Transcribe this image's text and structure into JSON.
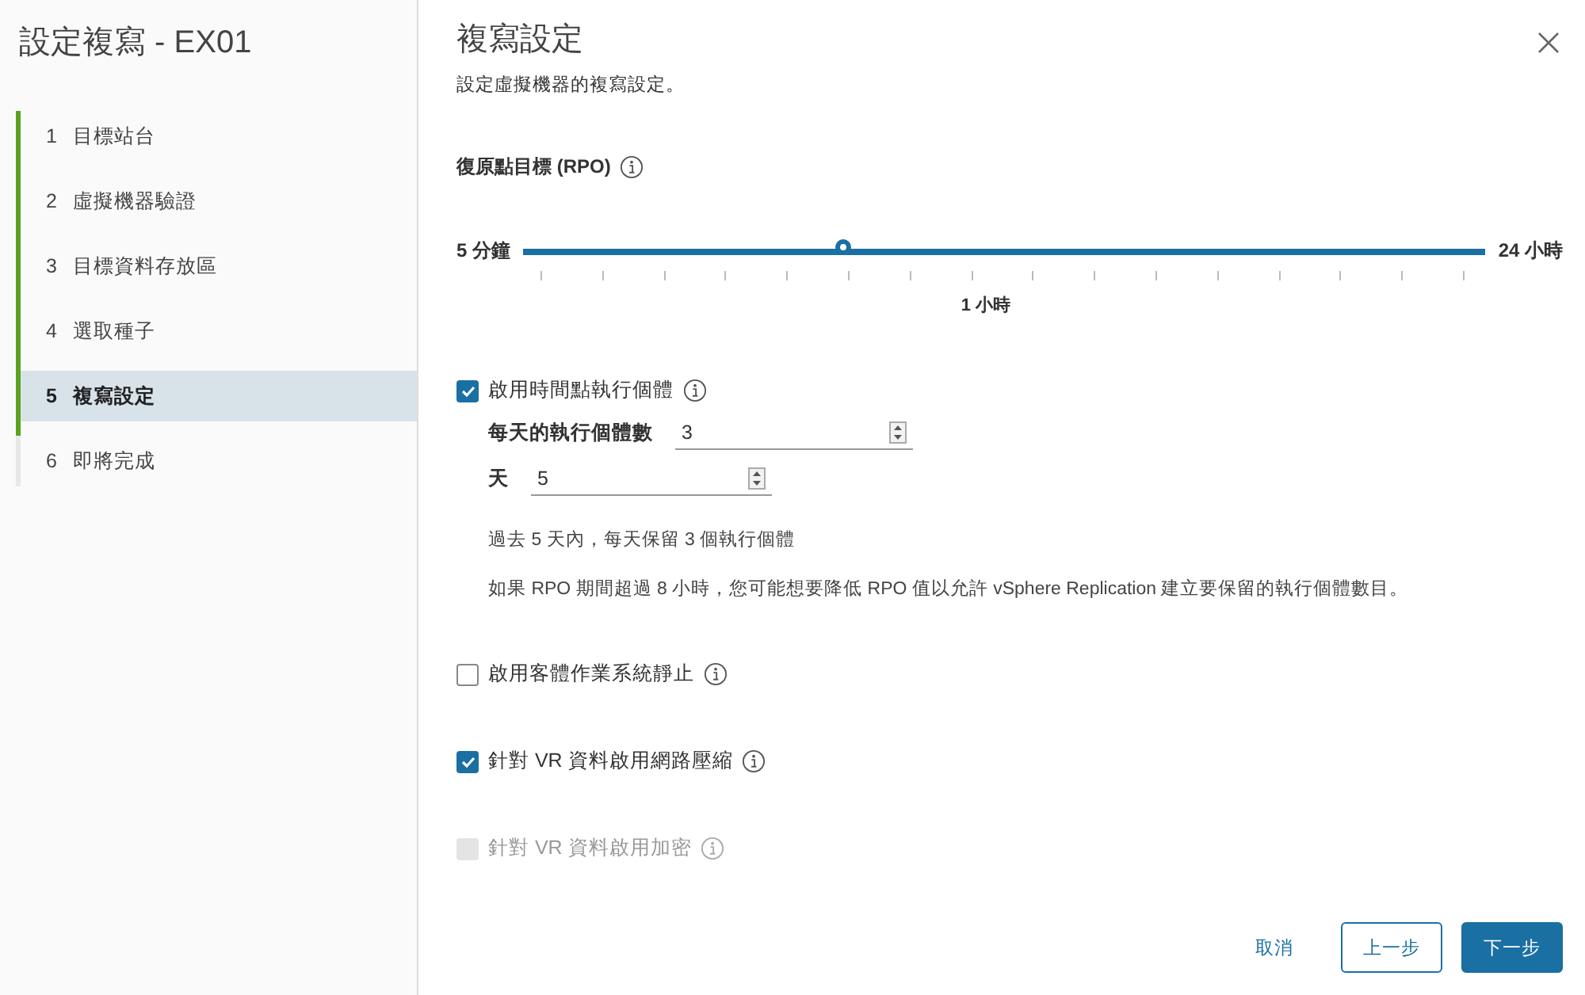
{
  "sidebar": {
    "title": "設定複寫 - EX01",
    "steps": [
      {
        "number": "1",
        "label": "目標站台",
        "completed": true,
        "selected": false
      },
      {
        "number": "2",
        "label": "虛擬機器驗證",
        "completed": true,
        "selected": false
      },
      {
        "number": "3",
        "label": "目標資料存放區",
        "completed": true,
        "selected": false
      },
      {
        "number": "4",
        "label": "選取種子",
        "completed": true,
        "selected": false
      },
      {
        "number": "5",
        "label": "複寫設定",
        "completed": true,
        "selected": true
      },
      {
        "number": "6",
        "label": "即將完成",
        "completed": false,
        "selected": false
      }
    ]
  },
  "main": {
    "title": "複寫設定",
    "subtitle": "設定虛擬機器的複寫設定。",
    "rpo": {
      "label": "復原點目標 (RPO)",
      "min_label": "5 分鐘",
      "max_label": "24 小時",
      "tick_label": "1 小時",
      "level": 0.338
    },
    "pit": {
      "label": "啟用時間點執行個體",
      "checked": true,
      "fields": [
        {
          "label": "每天的執行個體數",
          "value": "3"
        },
        {
          "label": "天",
          "value": "5"
        }
      ],
      "notes": [
        "過去 5 天內，每天保留 3 個執行個體",
        "如果 RPO 期間超過 8 小時，您可能想要降低 RPO 值以允許 vSphere Replication 建立要保留的執行個體數目。"
      ]
    },
    "options": [
      {
        "label": "啟用客體作業系統靜止",
        "checked": false,
        "disabled": false
      },
      {
        "label": "針對 VR 資料啟用網路壓縮",
        "checked": true,
        "disabled": false
      },
      {
        "label": "針對 VR 資料啟用加密",
        "checked": false,
        "disabled": true
      }
    ],
    "buttons": {
      "cancel": "取消",
      "back": "上一步",
      "next": "下一步"
    }
  }
}
